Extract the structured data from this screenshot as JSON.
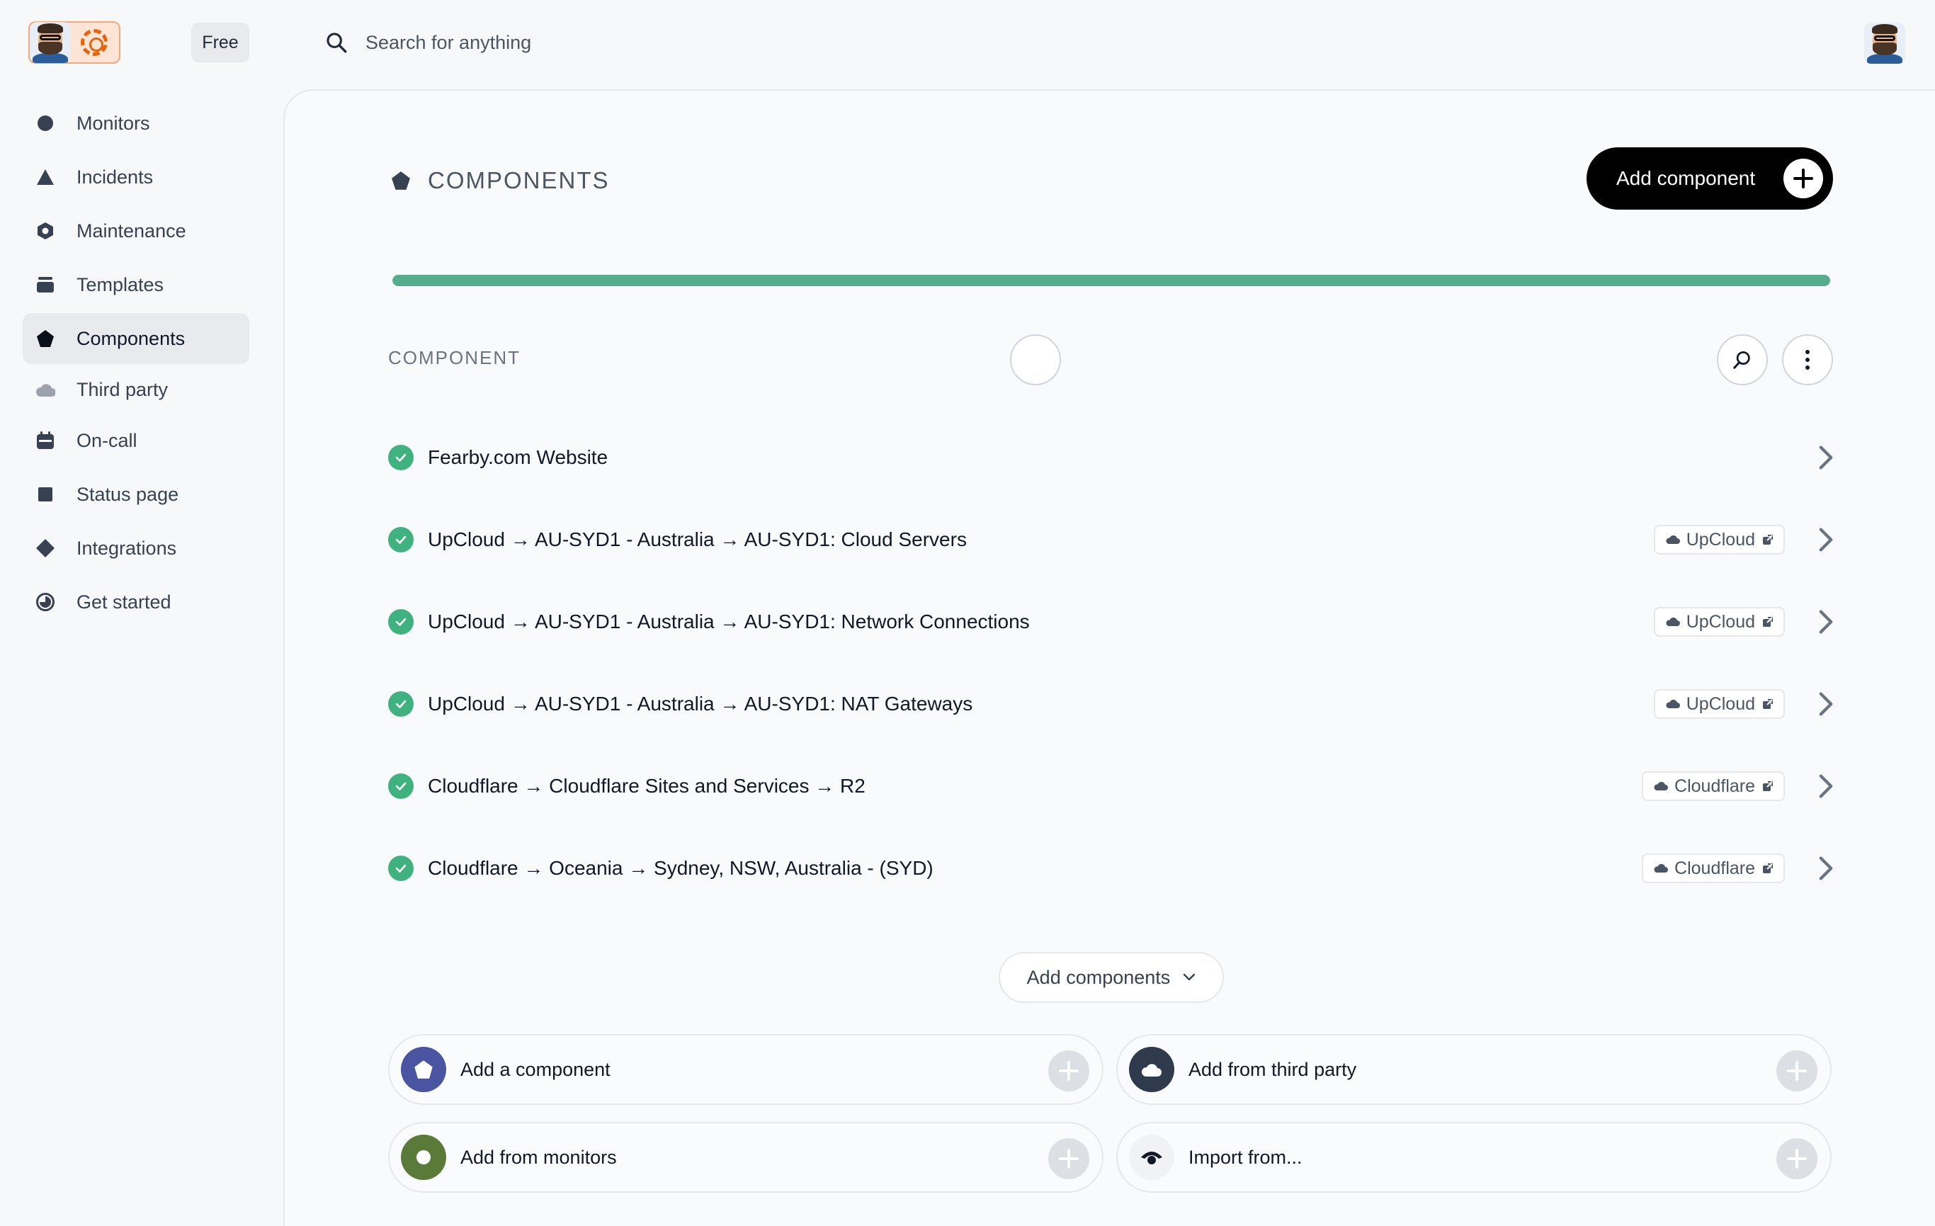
{
  "header": {
    "plan_badge": "Free",
    "search_placeholder": "Search for anything"
  },
  "sidebar": {
    "items": [
      {
        "label": "Monitors",
        "icon": "circle-icon"
      },
      {
        "label": "Incidents",
        "icon": "triangle-icon"
      },
      {
        "label": "Maintenance",
        "icon": "ring-icon"
      },
      {
        "label": "Templates",
        "icon": "stack-icon"
      },
      {
        "label": "Components",
        "icon": "pentagon-icon",
        "active": true
      },
      {
        "label": "Third party",
        "icon": "cloud-icon"
      },
      {
        "label": "On-call",
        "icon": "calendar-icon"
      },
      {
        "label": "Status page",
        "icon": "square-icon"
      },
      {
        "label": "Integrations",
        "icon": "diamond-icon"
      },
      {
        "label": "Get started",
        "icon": "clock-icon"
      }
    ]
  },
  "main": {
    "title": "COMPONENTS",
    "add_button_label": "Add component",
    "uptime_fraction": 1.0,
    "uptime_color": "#56ad8d",
    "column_header": "COMPONENT",
    "components": [
      {
        "name": "Fearby.com Website",
        "status": "operational",
        "tag": ""
      },
      {
        "name": "UpCloud → AU-SYD1 - Australia → AU-SYD1: Cloud Servers",
        "status": "operational",
        "tag": "UpCloud"
      },
      {
        "name": "UpCloud → AU-SYD1 - Australia → AU-SYD1: Network Connections",
        "status": "operational",
        "tag": "UpCloud"
      },
      {
        "name": "UpCloud → AU-SYD1 - Australia → AU-SYD1: NAT Gateways",
        "status": "operational",
        "tag": "UpCloud"
      },
      {
        "name": "Cloudflare → Cloudflare Sites and Services → R2",
        "status": "operational",
        "tag": "Cloudflare"
      },
      {
        "name": "Cloudflare → Oceania → Sydney, NSW, Australia - (SYD)",
        "status": "operational",
        "tag": "Cloudflare"
      }
    ],
    "add_components_label": "Add components",
    "add_options": [
      {
        "label": "Add a component",
        "icon": "pentagon-icon",
        "color": "#4a55a2"
      },
      {
        "label": "Add from third party",
        "icon": "cloud-icon",
        "color": "#2f3a4d"
      },
      {
        "label": "Add from monitors",
        "icon": "dot-icon",
        "color": "#5a7a3a"
      },
      {
        "label": "Import from...",
        "icon": "import-icon",
        "color": "#f1f2f4"
      }
    ]
  },
  "colors": {
    "status_ok": "#3fb27f",
    "active_nav_bg": "#e8eaed",
    "primary_button": "#000000"
  }
}
